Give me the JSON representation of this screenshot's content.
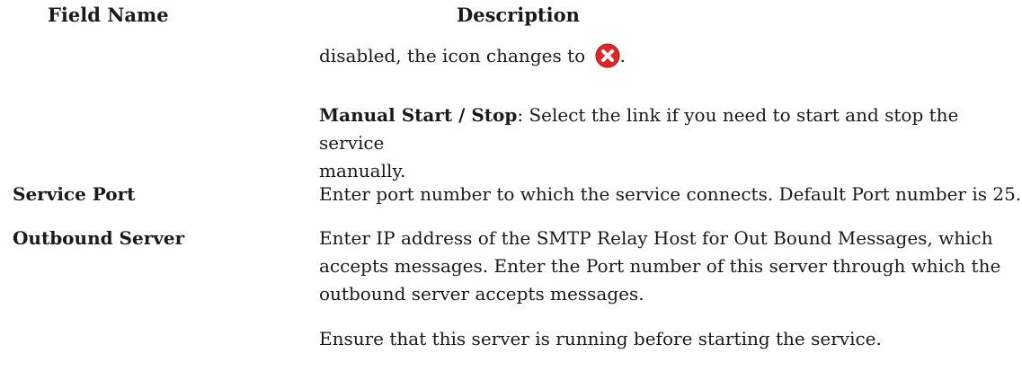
{
  "table": {
    "headers": {
      "field": "Field Name",
      "description": "Description"
    },
    "continued": {
      "text_before_icon": "disabled, the icon changes to",
      "icon": "red-x-circle-icon",
      "text_after_icon": ".",
      "manual_label": "Manual Start / Stop",
      "manual_text_line1": ": Select the link if you need to start and stop the service",
      "manual_text_line2": "manually."
    },
    "rows": [
      {
        "field": "Service Port",
        "description": [
          "Enter port number to which the service connects. Default Port number is 25."
        ]
      },
      {
        "field": "Outbound Server",
        "description": [
          "Enter IP address of the SMTP Relay Host for Out Bound Messages, which",
          "accepts messages. Enter the Port number of this server through which the",
          "outbound server accepts messages."
        ],
        "note": "Ensure that this server is running before starting the service."
      }
    ]
  },
  "colors": {
    "text": "#1a1a1a",
    "icon_red": "#e0282a"
  }
}
